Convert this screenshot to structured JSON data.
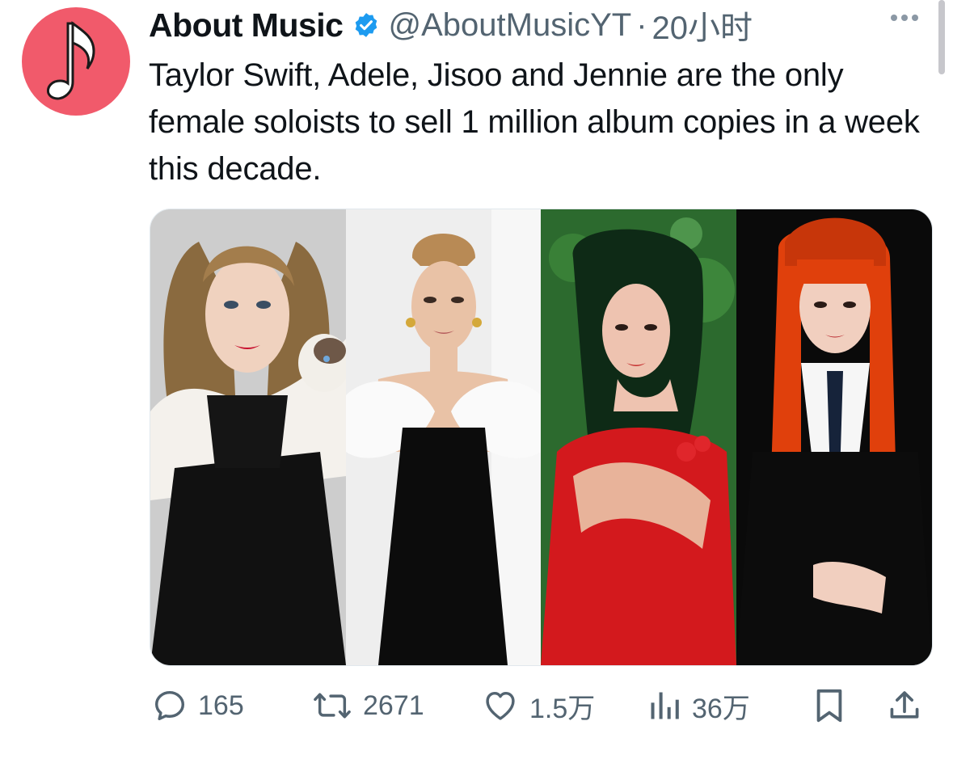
{
  "tweet": {
    "author_name": "About Music",
    "handle": "@AboutMusicYT",
    "separator": "·",
    "time": "20小时",
    "text": "Taylor Swift, Adele, Jisoo and Jennie are the only female soloists to sell 1 million album copies in a week this decade.",
    "verified_color": "#1d9bf0",
    "avatar_color": "#f15a6b",
    "avatar_icon": "music-note-icon"
  },
  "media": {
    "photos": [
      {
        "subject": "woman-with-cat-photo",
        "background": "#c9c9c9"
      },
      {
        "subject": "woman-white-black-gown-photo",
        "background": "#e8e8e8"
      },
      {
        "subject": "woman-red-dress-photo",
        "background": "#2f6b2f"
      },
      {
        "subject": "woman-red-hair-photo",
        "background": "#0b0b0b"
      }
    ]
  },
  "actions": {
    "replies": "165",
    "retweets": "2671",
    "likes": "1.5万",
    "views": "36万",
    "icon_color": "#536471"
  }
}
